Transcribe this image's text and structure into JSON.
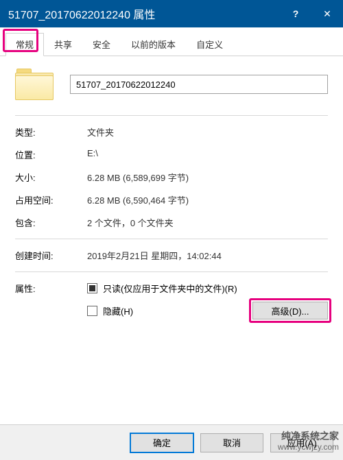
{
  "titlebar": {
    "title": "51707_20170622012240 属性",
    "help": "?",
    "close": "✕"
  },
  "tabs": [
    {
      "label": "常规",
      "active": true
    },
    {
      "label": "共享",
      "active": false
    },
    {
      "label": "安全",
      "active": false
    },
    {
      "label": "以前的版本",
      "active": false
    },
    {
      "label": "自定义",
      "active": false
    }
  ],
  "general": {
    "name": "51707_20170622012240",
    "type_label": "类型:",
    "type_value": "文件夹",
    "location_label": "位置:",
    "location_value": "E:\\",
    "size_label": "大小:",
    "size_value": "6.28 MB (6,589,699 字节)",
    "disk_label": "占用空间:",
    "disk_value": "6.28 MB (6,590,464 字节)",
    "contains_label": "包含:",
    "contains_value": "2 个文件，0 个文件夹",
    "created_label": "创建时间:",
    "created_value": "2019年2月21日 星期四，14:02:44",
    "attr_label": "属性:",
    "readonly_label": "只读(仅应用于文件夹中的文件)(R)",
    "hidden_label": "隐藏(H)",
    "advanced_label": "高级(D)..."
  },
  "buttons": {
    "ok": "确定",
    "cancel": "取消",
    "apply": "应用(A)"
  },
  "watermark": {
    "zh": "纯净系统之家",
    "url": "www.ycwjzy.com"
  }
}
